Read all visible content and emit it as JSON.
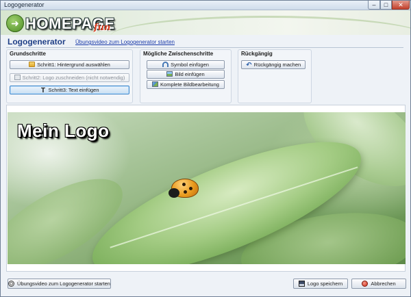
{
  "window": {
    "title": "Logogenerator",
    "controls": {
      "minimize": "–",
      "maximize": "□",
      "close": "✕"
    }
  },
  "header": {
    "brand_word": "HOMEPAGE",
    "brand_suffix": "fun",
    "brand_arrow": "➜"
  },
  "page": {
    "title": "Logogenerator",
    "video_link": "Übungsvideo zum Logogenerator starten"
  },
  "groups": {
    "basic": {
      "title": "Grundschritte",
      "buttons": [
        {
          "label": "Schritt1: Hintergrund auswählen",
          "icon": "folder-icon",
          "state": "normal"
        },
        {
          "label": "Schritt2: Logo zuschneiden (nicht notwendig)",
          "icon": "crop-icon",
          "state": "disabled"
        },
        {
          "label": "Schritt3: Text einfügen",
          "icon": "text-icon",
          "icon_glyph": "T",
          "state": "selected"
        }
      ]
    },
    "optional": {
      "title": "Mögliche Zwischenschritte",
      "buttons": [
        {
          "label": "Symbol einfügen",
          "icon": "headset-icon"
        },
        {
          "label": "Bild einfügen",
          "icon": "image-icon"
        },
        {
          "label": "Komplete Bildbearbeitung",
          "icon": "image-edit-icon"
        }
      ]
    },
    "undo": {
      "title": "Rückgängig",
      "buttons": [
        {
          "label": "Rückgängig machen",
          "icon": "undo-icon",
          "icon_glyph": "↶"
        }
      ]
    }
  },
  "preview": {
    "logo_text": "Mein Logo"
  },
  "footer": {
    "video_button": "Übungsvideo zum Logogenerator starten",
    "save_button": "Logo speichern",
    "cancel_button": "Abbrechen"
  },
  "colors": {
    "accent": "#1f3f86",
    "link": "#1939a8",
    "selected_border": "#3f86c9",
    "cancel": "#cf2a17"
  }
}
